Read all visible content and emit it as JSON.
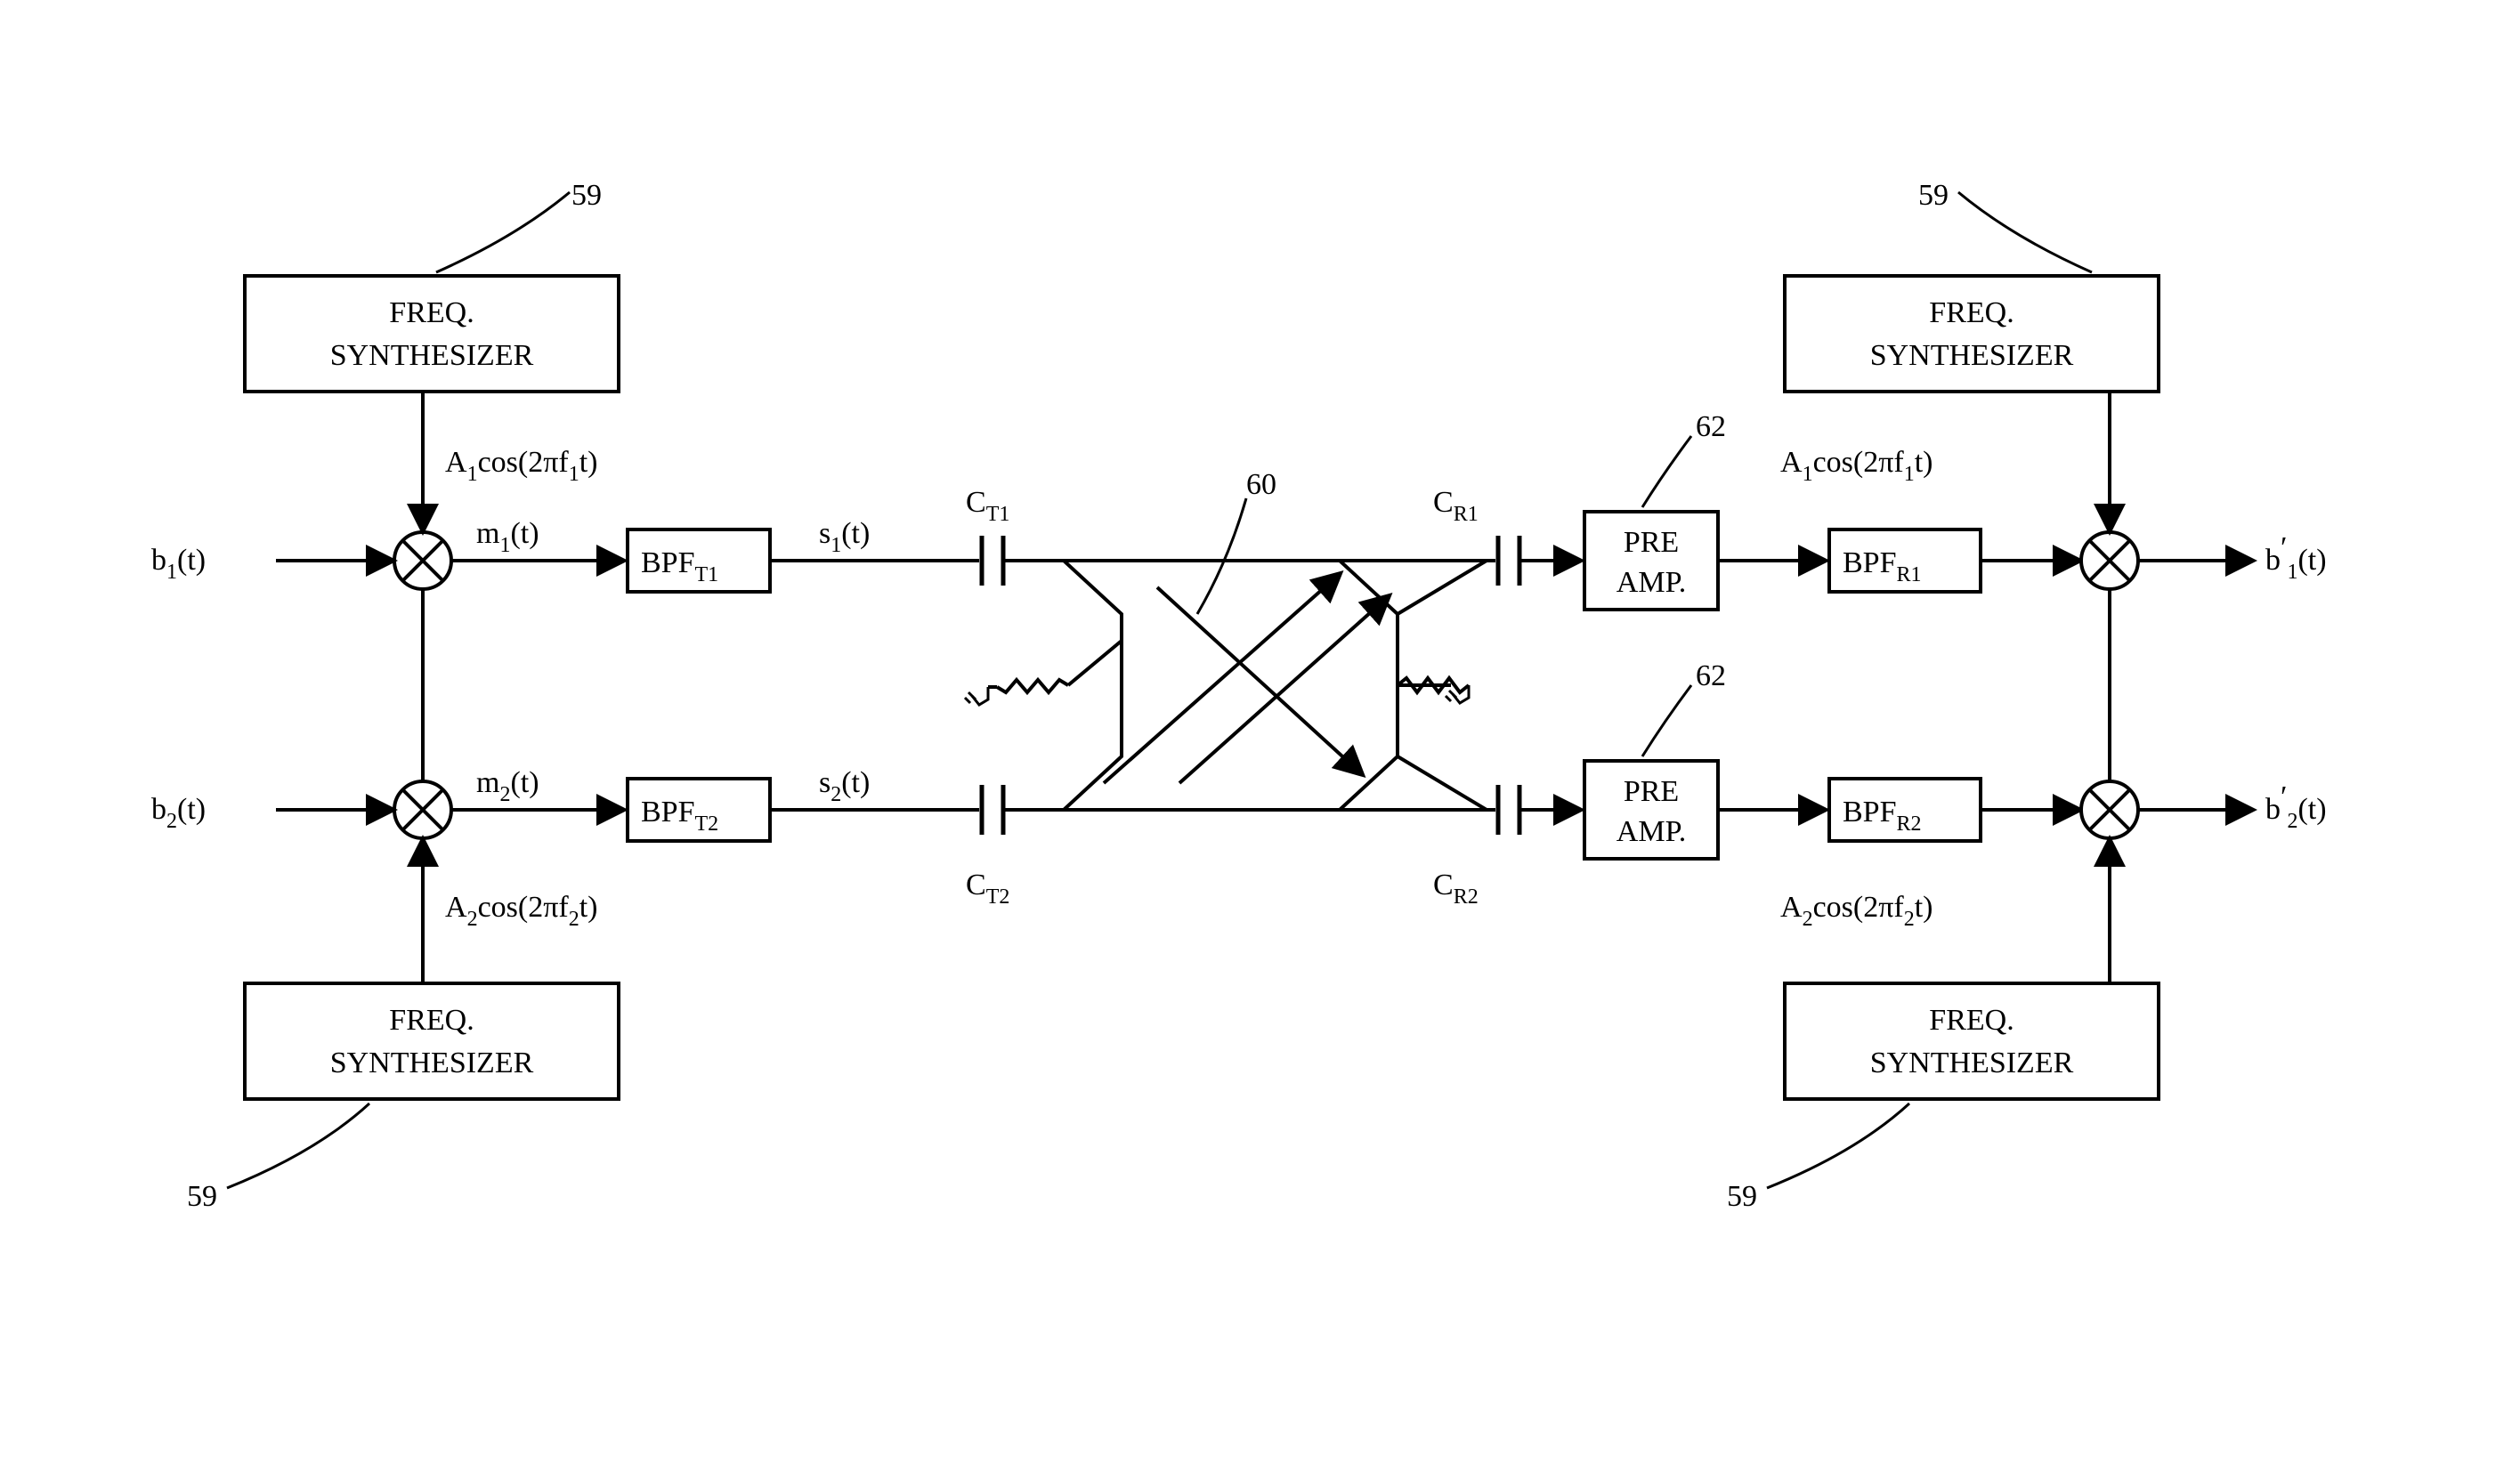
{
  "ref": {
    "tl": "59",
    "bl": "59",
    "tr": "59",
    "br": "59",
    "center": "60",
    "amp": "62"
  },
  "synth": {
    "l1": "FREQ.",
    "l2": "SYNTHESIZER"
  },
  "amp": {
    "l1": "PRE",
    "l2": "AMP."
  },
  "bpf": {
    "t1": "BPF",
    "t1s": "T1",
    "t2": "BPF",
    "t2s": "T2",
    "r1": "BPF",
    "r1s": "R1",
    "r2": "BPF",
    "r2s": "R2"
  },
  "sig": {
    "b1": "b",
    "b1s": "1",
    "b1t": "(t)",
    "b2": "b",
    "b2s": "2",
    "b2t": "(t)",
    "m1": "m",
    "m1s": "1",
    "m1t": "(t)",
    "m2": "m",
    "m2s": "2",
    "m2t": "(t)",
    "s1": "s",
    "s1s": "1",
    "s1t": "(t)",
    "s2": "s",
    "s2s": "2",
    "s2t": "(t)",
    "bp1": "b",
    "bp1p": "′",
    "bp1s": "1",
    "bp1t": "(t)",
    "bp2": "b",
    "bp2p": "′",
    "bp2s": "2",
    "bp2t": "(t)",
    "a1a": "A",
    "a1as": "1",
    "a1b": "cos(2πf",
    "a1bs": "1",
    "a1c": "t)",
    "a2a": "A",
    "a2as": "2",
    "a2b": "cos(2πf",
    "a2bs": "2",
    "a2c": "t)"
  },
  "cap": {
    "ct1": "C",
    "ct1s": "T1",
    "ct2": "C",
    "ct2s": "T2",
    "cr1": "C",
    "cr1s": "R1",
    "cr2": "C",
    "cr2s": "R2"
  }
}
